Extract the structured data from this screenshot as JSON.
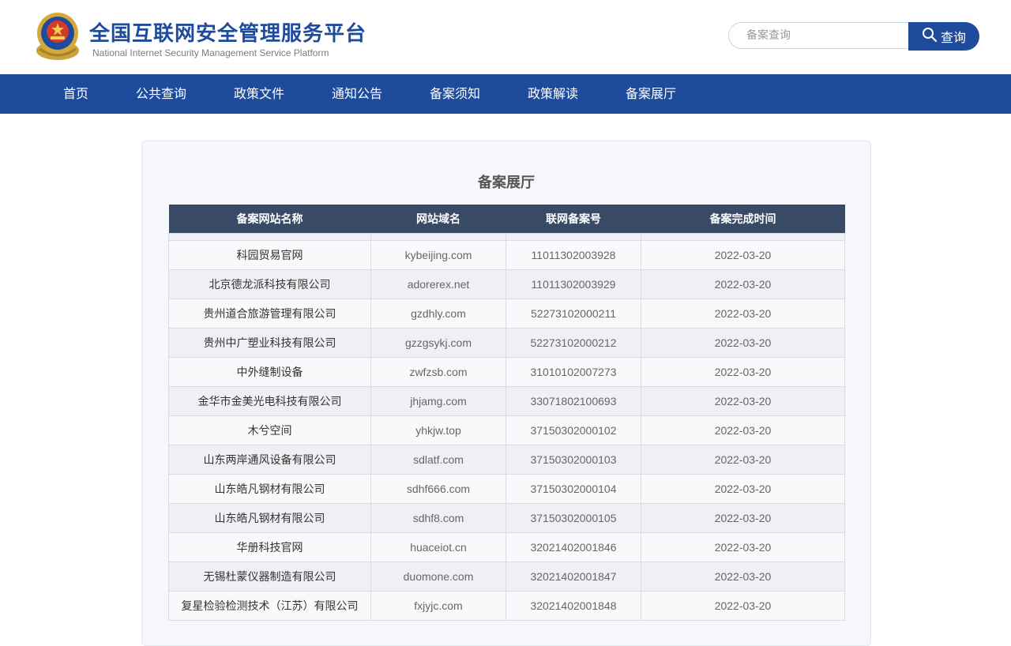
{
  "header": {
    "title": "全国互联网安全管理服务平台",
    "subtitle": "National Internet Security Management Service Platform",
    "search": {
      "placeholder": "备案查询",
      "button_label": "查询",
      "button_icon": "search-icon"
    }
  },
  "nav": {
    "items": [
      {
        "label": "首页"
      },
      {
        "label": "公共查询"
      },
      {
        "label": "政策文件"
      },
      {
        "label": "通知公告"
      },
      {
        "label": "备案须知"
      },
      {
        "label": "政策解读"
      },
      {
        "label": "备案展厅"
      }
    ]
  },
  "main": {
    "title": "备案展厅",
    "table": {
      "headers": [
        "备案网站名称",
        "网站域名",
        "联网备案号",
        "备案完成时间"
      ],
      "rows": [
        {
          "name": "科园贸易官网",
          "domain": "kybeijing.com",
          "icp": "11011302003928",
          "date": "2022-03-20"
        },
        {
          "name": "北京德龙派科技有限公司",
          "domain": "adorerex.net",
          "icp": "11011302003929",
          "date": "2022-03-20"
        },
        {
          "name": "贵州道合旅游管理有限公司",
          "domain": "gzdhly.com",
          "icp": "52273102000211",
          "date": "2022-03-20"
        },
        {
          "name": "贵州中广塑业科技有限公司",
          "domain": "gzzgsykj.com",
          "icp": "52273102000212",
          "date": "2022-03-20"
        },
        {
          "name": "中外缝制设备",
          "domain": "zwfzsb.com",
          "icp": "31010102007273",
          "date": "2022-03-20"
        },
        {
          "name": "金华市金美光电科技有限公司",
          "domain": "jhjamg.com",
          "icp": "33071802100693",
          "date": "2022-03-20"
        },
        {
          "name": "木兮空间",
          "domain": "yhkjw.top",
          "icp": "37150302000102",
          "date": "2022-03-20"
        },
        {
          "name": "山东两岸通风设备有限公司",
          "domain": "sdlatf.com",
          "icp": "37150302000103",
          "date": "2022-03-20"
        },
        {
          "name": "山东皓凡钢材有限公司",
          "domain": "sdhf666.com",
          "icp": "37150302000104",
          "date": "2022-03-20"
        },
        {
          "name": "山东皓凡钢材有限公司",
          "domain": "sdhf8.com",
          "icp": "37150302000105",
          "date": "2022-03-20"
        },
        {
          "name": "华册科技官网",
          "domain": "huaceiot.cn",
          "icp": "32021402001846",
          "date": "2022-03-20"
        },
        {
          "name": "无锡杜蒙仪器制造有限公司",
          "domain": "duomone.com",
          "icp": "32021402001847",
          "date": "2022-03-20"
        },
        {
          "name": "复星检验检测技术（江苏）有限公司",
          "domain": "fxjyjc.com",
          "icp": "32021402001848",
          "date": "2022-03-20"
        }
      ]
    }
  },
  "colors": {
    "brand_blue": "#1f4b9c",
    "table_header": "#384a66"
  }
}
